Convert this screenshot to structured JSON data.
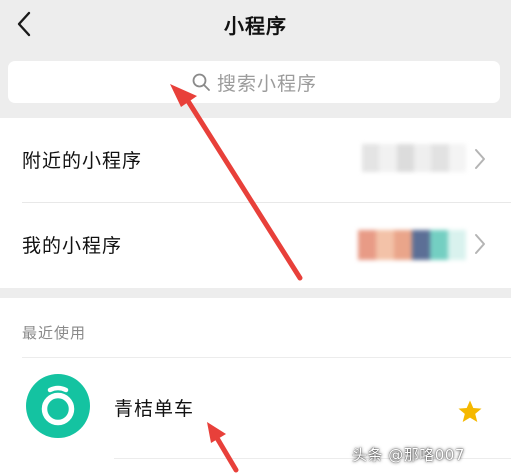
{
  "header": {
    "title": "小程序",
    "back_icon": "chevron-left-icon"
  },
  "search": {
    "placeholder": "搜索小程序",
    "icon": "search-icon"
  },
  "menu": {
    "items": [
      {
        "label": "附近的小程序",
        "icon": "chevron-right-icon"
      },
      {
        "label": "我的小程序",
        "icon": "chevron-right-icon"
      }
    ]
  },
  "recent": {
    "title": "最近使用",
    "apps": [
      {
        "name": "青桔单车",
        "icon": "qingju-bike-logo",
        "icon_color": "#14c3a1",
        "starred": true,
        "star_color": "#f5b800"
      }
    ]
  },
  "watermark": {
    "text": "头条 @那咯007"
  },
  "colors": {
    "annotation_arrow": "#e8403a",
    "background": "#ededed"
  }
}
